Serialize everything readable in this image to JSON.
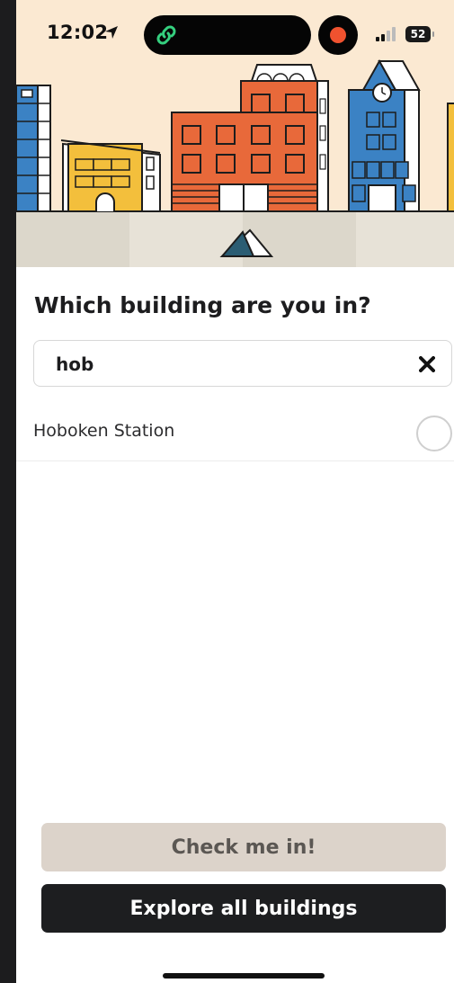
{
  "status_bar": {
    "time": "12:02",
    "battery": "52",
    "icons": [
      "location-arrow-icon",
      "link-icon",
      "record-icon",
      "signal-icon",
      "battery-icon"
    ]
  },
  "hero": {
    "illustration": "city-buildings-illustration",
    "colors": {
      "sky": "#fbe9d2",
      "orange": "#e8693a",
      "blue": "#3b82c4",
      "yellow": "#f3bf3c",
      "ground": "#ddd8cc"
    }
  },
  "page": {
    "title": "Which building are you in?"
  },
  "search": {
    "value": "hob",
    "placeholder": "",
    "clear_icon": "close-icon"
  },
  "results": [
    {
      "label": "Hoboken Station",
      "selected": false
    }
  ],
  "buttons": {
    "check_in": "Check me in!",
    "explore": "Explore all buildings"
  },
  "colors": {
    "check_in_bg": "#dcd3ca",
    "explore_bg": "#1d1e20"
  }
}
